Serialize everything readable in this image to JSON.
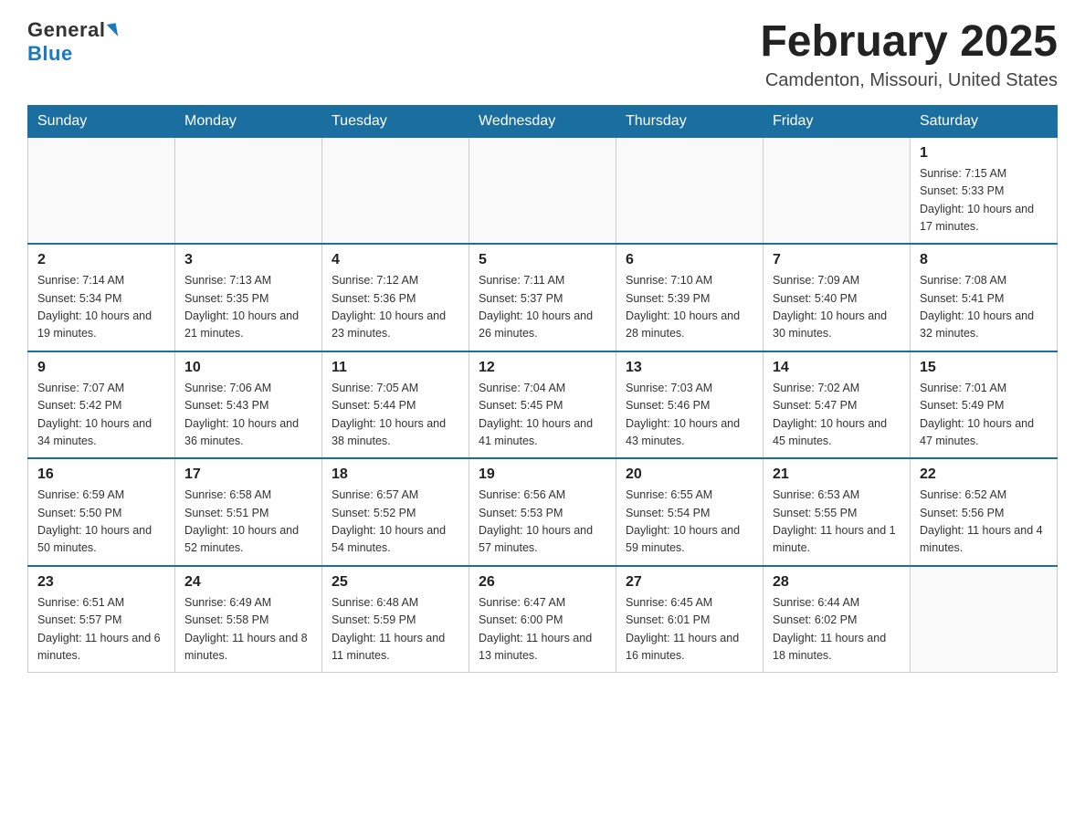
{
  "header": {
    "logo_general": "General",
    "logo_blue": "Blue",
    "title": "February 2025",
    "subtitle": "Camdenton, Missouri, United States"
  },
  "weekdays": [
    "Sunday",
    "Monday",
    "Tuesday",
    "Wednesday",
    "Thursday",
    "Friday",
    "Saturday"
  ],
  "weeks": [
    {
      "days": [
        {
          "num": "",
          "info": ""
        },
        {
          "num": "",
          "info": ""
        },
        {
          "num": "",
          "info": ""
        },
        {
          "num": "",
          "info": ""
        },
        {
          "num": "",
          "info": ""
        },
        {
          "num": "",
          "info": ""
        },
        {
          "num": "1",
          "info": "Sunrise: 7:15 AM\nSunset: 5:33 PM\nDaylight: 10 hours and 17 minutes."
        }
      ]
    },
    {
      "days": [
        {
          "num": "2",
          "info": "Sunrise: 7:14 AM\nSunset: 5:34 PM\nDaylight: 10 hours and 19 minutes."
        },
        {
          "num": "3",
          "info": "Sunrise: 7:13 AM\nSunset: 5:35 PM\nDaylight: 10 hours and 21 minutes."
        },
        {
          "num": "4",
          "info": "Sunrise: 7:12 AM\nSunset: 5:36 PM\nDaylight: 10 hours and 23 minutes."
        },
        {
          "num": "5",
          "info": "Sunrise: 7:11 AM\nSunset: 5:37 PM\nDaylight: 10 hours and 26 minutes."
        },
        {
          "num": "6",
          "info": "Sunrise: 7:10 AM\nSunset: 5:39 PM\nDaylight: 10 hours and 28 minutes."
        },
        {
          "num": "7",
          "info": "Sunrise: 7:09 AM\nSunset: 5:40 PM\nDaylight: 10 hours and 30 minutes."
        },
        {
          "num": "8",
          "info": "Sunrise: 7:08 AM\nSunset: 5:41 PM\nDaylight: 10 hours and 32 minutes."
        }
      ]
    },
    {
      "days": [
        {
          "num": "9",
          "info": "Sunrise: 7:07 AM\nSunset: 5:42 PM\nDaylight: 10 hours and 34 minutes."
        },
        {
          "num": "10",
          "info": "Sunrise: 7:06 AM\nSunset: 5:43 PM\nDaylight: 10 hours and 36 minutes."
        },
        {
          "num": "11",
          "info": "Sunrise: 7:05 AM\nSunset: 5:44 PM\nDaylight: 10 hours and 38 minutes."
        },
        {
          "num": "12",
          "info": "Sunrise: 7:04 AM\nSunset: 5:45 PM\nDaylight: 10 hours and 41 minutes."
        },
        {
          "num": "13",
          "info": "Sunrise: 7:03 AM\nSunset: 5:46 PM\nDaylight: 10 hours and 43 minutes."
        },
        {
          "num": "14",
          "info": "Sunrise: 7:02 AM\nSunset: 5:47 PM\nDaylight: 10 hours and 45 minutes."
        },
        {
          "num": "15",
          "info": "Sunrise: 7:01 AM\nSunset: 5:49 PM\nDaylight: 10 hours and 47 minutes."
        }
      ]
    },
    {
      "days": [
        {
          "num": "16",
          "info": "Sunrise: 6:59 AM\nSunset: 5:50 PM\nDaylight: 10 hours and 50 minutes."
        },
        {
          "num": "17",
          "info": "Sunrise: 6:58 AM\nSunset: 5:51 PM\nDaylight: 10 hours and 52 minutes."
        },
        {
          "num": "18",
          "info": "Sunrise: 6:57 AM\nSunset: 5:52 PM\nDaylight: 10 hours and 54 minutes."
        },
        {
          "num": "19",
          "info": "Sunrise: 6:56 AM\nSunset: 5:53 PM\nDaylight: 10 hours and 57 minutes."
        },
        {
          "num": "20",
          "info": "Sunrise: 6:55 AM\nSunset: 5:54 PM\nDaylight: 10 hours and 59 minutes."
        },
        {
          "num": "21",
          "info": "Sunrise: 6:53 AM\nSunset: 5:55 PM\nDaylight: 11 hours and 1 minute."
        },
        {
          "num": "22",
          "info": "Sunrise: 6:52 AM\nSunset: 5:56 PM\nDaylight: 11 hours and 4 minutes."
        }
      ]
    },
    {
      "days": [
        {
          "num": "23",
          "info": "Sunrise: 6:51 AM\nSunset: 5:57 PM\nDaylight: 11 hours and 6 minutes."
        },
        {
          "num": "24",
          "info": "Sunrise: 6:49 AM\nSunset: 5:58 PM\nDaylight: 11 hours and 8 minutes."
        },
        {
          "num": "25",
          "info": "Sunrise: 6:48 AM\nSunset: 5:59 PM\nDaylight: 11 hours and 11 minutes."
        },
        {
          "num": "26",
          "info": "Sunrise: 6:47 AM\nSunset: 6:00 PM\nDaylight: 11 hours and 13 minutes."
        },
        {
          "num": "27",
          "info": "Sunrise: 6:45 AM\nSunset: 6:01 PM\nDaylight: 11 hours and 16 minutes."
        },
        {
          "num": "28",
          "info": "Sunrise: 6:44 AM\nSunset: 6:02 PM\nDaylight: 11 hours and 18 minutes."
        },
        {
          "num": "",
          "info": ""
        }
      ]
    }
  ]
}
